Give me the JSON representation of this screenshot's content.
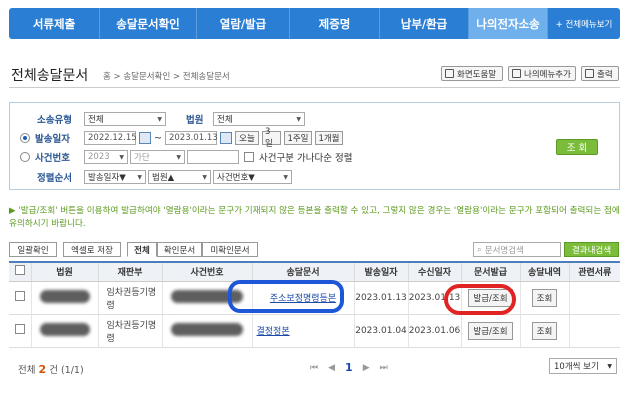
{
  "nav": {
    "items": [
      "서류제출",
      "송달문서확인",
      "열람/발급",
      "제증명",
      "납부/환급",
      "나의전자소송"
    ],
    "all_menu": "+ 전체메뉴보기"
  },
  "page": {
    "title": "전체송달문서",
    "breadcrumb": "홈 > 송달문서확인 > 전체송달문서"
  },
  "tools": {
    "help": "화면도움말",
    "my_menu": "나의메뉴추가",
    "print": "출력"
  },
  "search": {
    "case_type_label": "소송유형",
    "case_type_value": "전체",
    "court_label": "법원",
    "court_value": "전체",
    "send_date_label": "발송일자",
    "date_from": "2022.12.15",
    "date_sep": "~",
    "date_to": "2023.01.13",
    "period_buttons": [
      "오늘",
      "3일",
      "1주일",
      "1개월"
    ],
    "case_no_label": "사건번호",
    "case_year": "2023",
    "case_kind": "가단",
    "case_num": "",
    "case_sort_check": "사건구분 가나다순 정렬",
    "sort_label": "정렬순서",
    "sort1": "발송일자▼",
    "sort2": "법원▲",
    "sort3": "사건번호▼",
    "query_button": "조 회"
  },
  "notice": "▶ '발급/조회' 버튼을 이용하여 발급하여야 '열람용'이라는 문구가 기재되지 않은 등본을 출력할 수 있고, 그렇지 않은 경우는 '열람용'이라는 문구가 포함되어 출력되는 점에 유의하시기 바랍니다.",
  "actions": {
    "bulk_confirm": "일괄확인",
    "excel": "엑셀로 저장"
  },
  "tabs": [
    "전체",
    "확인문서",
    "미확인문서"
  ],
  "doc_search": {
    "placeholder": "문서명검색",
    "result_button": "결과내검색"
  },
  "table": {
    "headers": [
      "법원",
      "재판부",
      "사건번호",
      "송달문서",
      "발송일자",
      "수신일자",
      "문서발급",
      "송달내역",
      "관련서류"
    ],
    "rows": [
      {
        "division": "임차권등기명령",
        "document": "주소보정명령등본",
        "send_date": "2023.01.13",
        "recv_date": "2023.01.13",
        "issue": "발급/조회",
        "history": "조회"
      },
      {
        "division": "임차권등기명령",
        "document": "결정정본",
        "send_date": "2023.01.04",
        "recv_date": "2023.01.06",
        "issue": "발급/조회",
        "history": "조회"
      }
    ]
  },
  "footer": {
    "total_prefix": "전체",
    "total_count": "2",
    "total_suffix": "건 (1/1)",
    "first": "⏮",
    "prev": "◀",
    "page": "1",
    "next": "▶",
    "last": "⏭",
    "per_page": "10개씩 보기"
  },
  "colors": {
    "nav_bg": "#2a7fd4",
    "nav_active": "#6fb0ec",
    "accent_green": "#7bbd3a",
    "annotation_blue": "#1e56d8",
    "annotation_red": "#e02424"
  }
}
